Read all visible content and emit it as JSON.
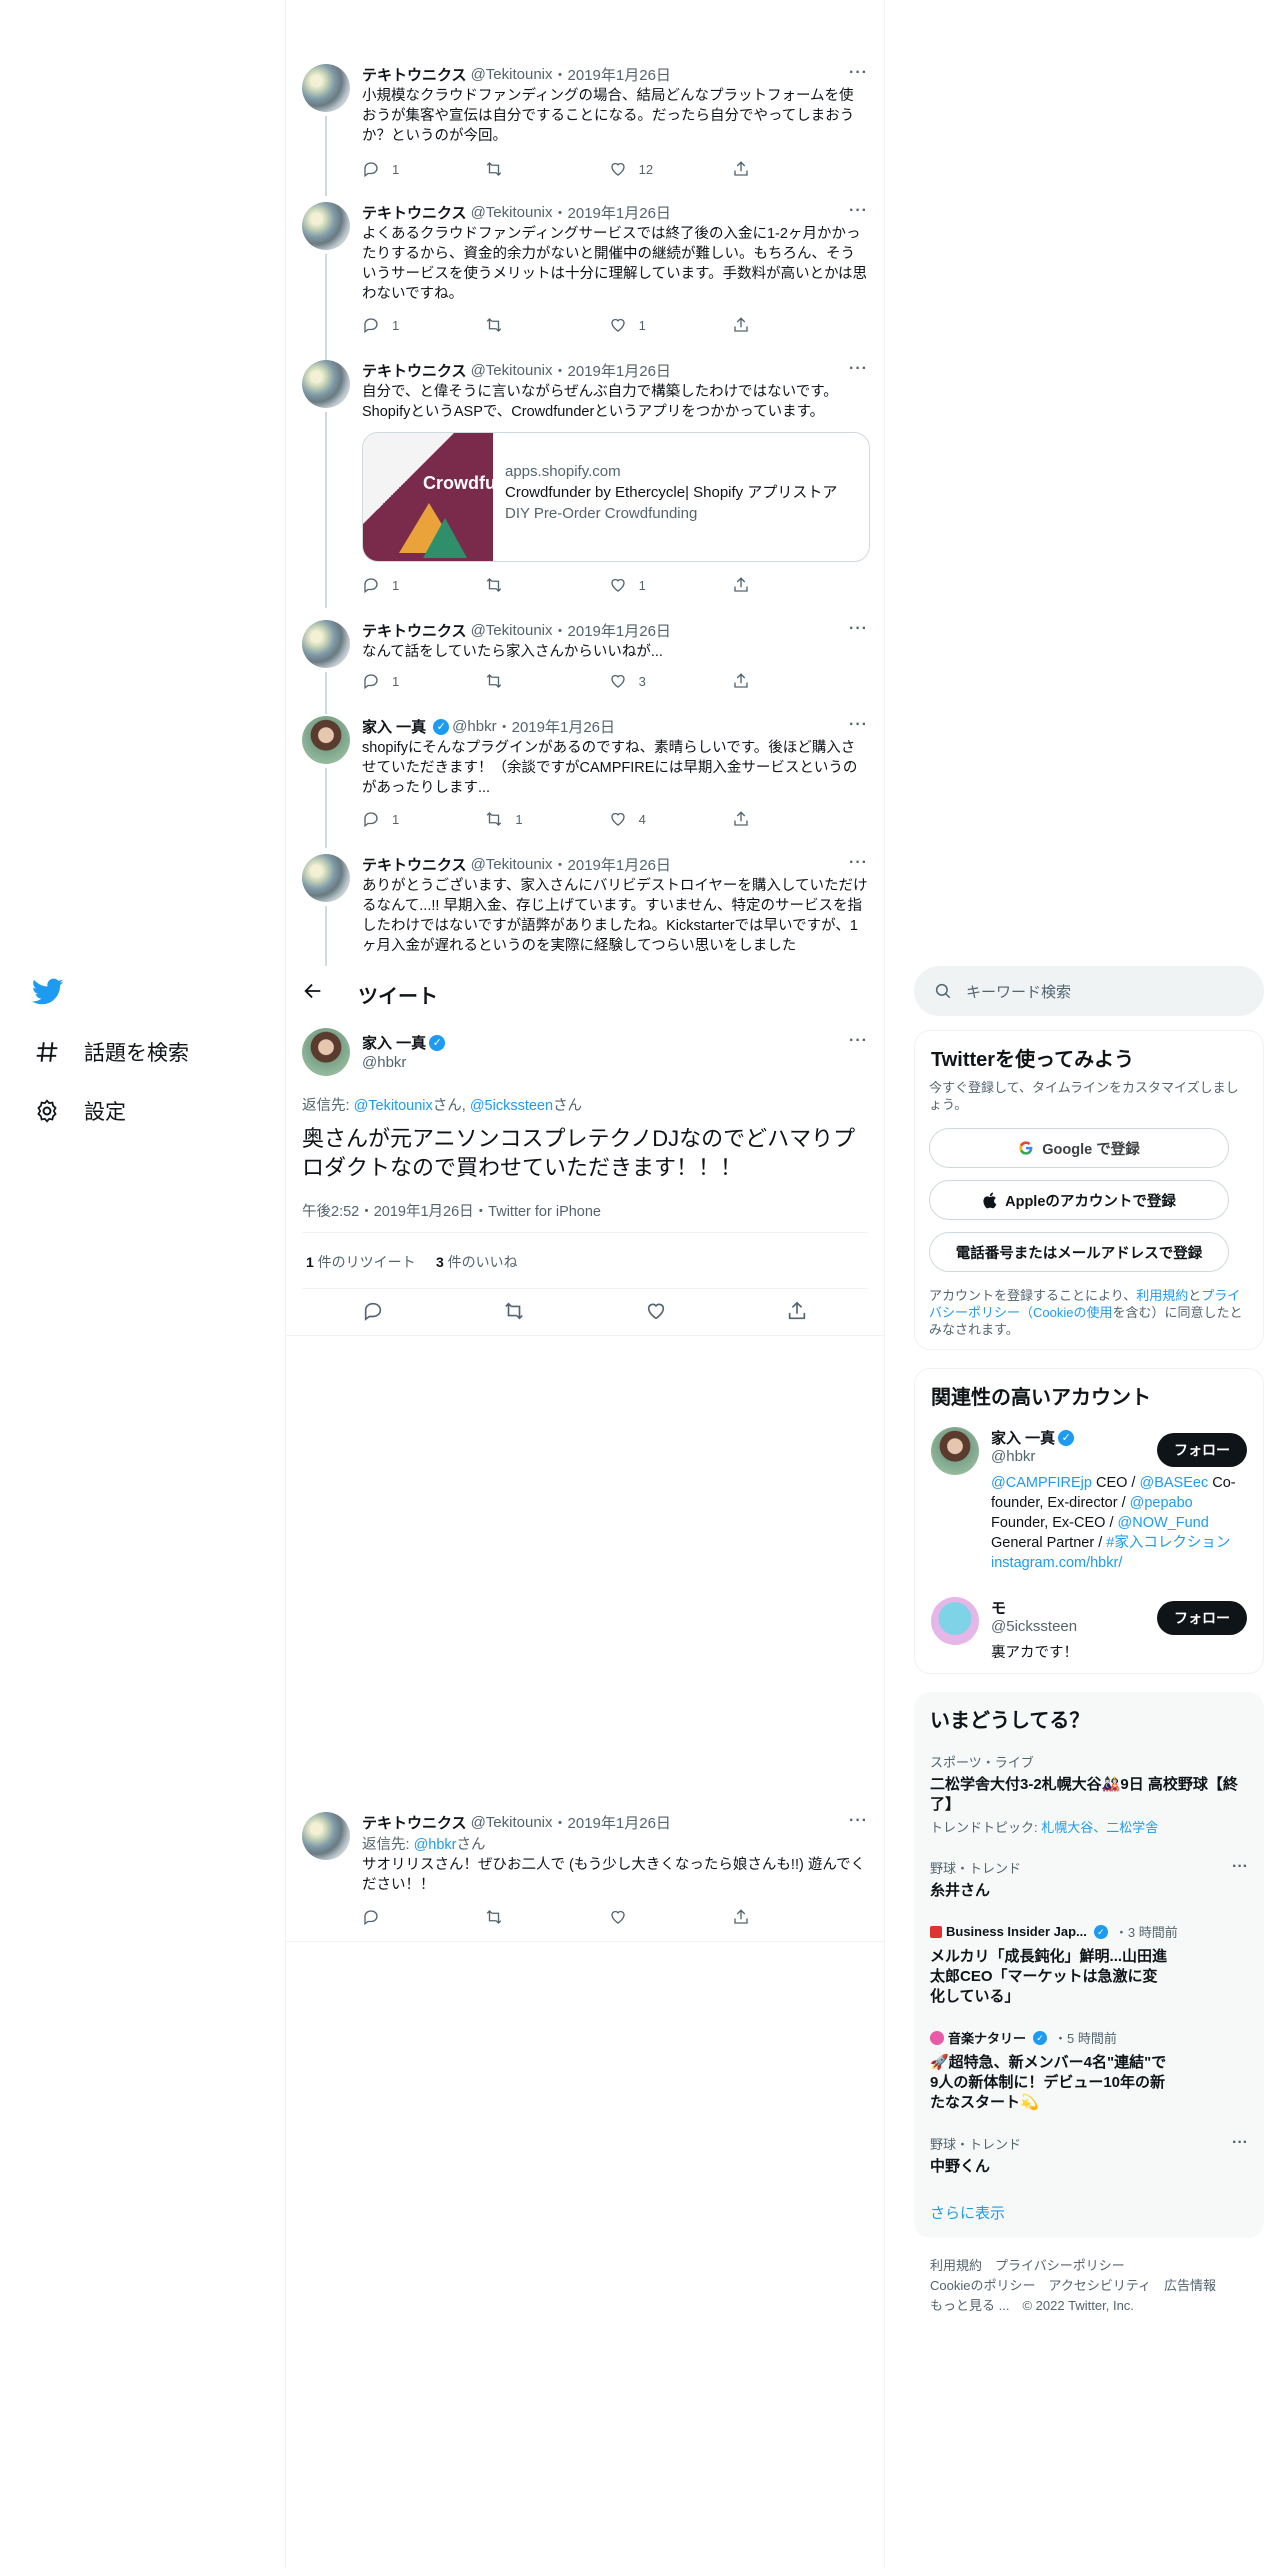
{
  "nav": {
    "explore": "話題を検索",
    "settings": "設定"
  },
  "tweets_above": [
    {
      "name": "テキトウニクス",
      "handle": "@Tekitounix",
      "date": "2019年1月26日",
      "text": "小規模なクラウドファンディングの場合、結局どんなプラットフォームを使おうが集客や宣伝は自分ですることになる。だったら自分でやってしまおうか？というのが今回。",
      "reply": "1",
      "retweet": "",
      "like": "12"
    },
    {
      "name": "テキトウニクス",
      "handle": "@Tekitounix",
      "date": "2019年1月26日",
      "text": "よくあるクラウドファンディングサービスでは終了後の入金に1-2ヶ月かかったりするから、資金的余力がないと開催中の継続が難しい。もちろん、そういうサービスを使うメリットは十分に理解しています。手数料が高いとかは思わないですね。",
      "reply": "1",
      "retweet": "",
      "like": "1"
    },
    {
      "name": "テキトウニクス",
      "handle": "@Tekitounix",
      "date": "2019年1月26日",
      "text": "自分で、と偉そうに言いながらぜんぶ自力で構築したわけではないです。ShopifyというASPで、Crowdfunderというアプリをつかかっています。",
      "card": {
        "domain": "apps.shopify.com",
        "title": "Crowdfunder by Ethercycle| Shopify アプリストア",
        "desc": "DIY Pre-Order Crowdfunding",
        "img_word": "Crowdfu"
      },
      "reply": "1",
      "retweet": "",
      "like": "1"
    },
    {
      "name": "テキトウニクス",
      "handle": "@Tekitounix",
      "date": "2019年1月26日",
      "text": "なんて話をしていたら家入さんからいいねが...",
      "reply": "1",
      "retweet": "",
      "like": "3"
    },
    {
      "name": "家入 一真",
      "handle": "@hbkr",
      "date": "2019年1月26日",
      "text": "shopifyにそんなプラグインがあるのですね、素晴らしいです。後ほど購入させていただきます！（余談ですがCAMPFIREには早期入金サービスというのがあったりします...",
      "reply": "1",
      "retweet": "1",
      "like": "4"
    },
    {
      "name": "テキトウニクス",
      "handle": "@Tekitounix",
      "date": "2019年1月26日",
      "text": "ありがとうございます、家入さんにバリビデストロイヤーを購入していただけるなんて...!! 早期入金、存じ上げています。すいません、特定のサービスを指したわけではないですが語弊がありましたね。Kickstarterでは早いですが、1ヶ月入金が遅れるというのを実際に経験してつらい思いをしました"
    }
  ],
  "header": {
    "title": "ツイート"
  },
  "focus": {
    "name": "家入 一真",
    "handle": "@hbkr",
    "reply_prefix": "返信先: ",
    "reply_to_1": "@Tekitounix",
    "reply_mid": "さん, ",
    "reply_to_2": "@5ickssteen",
    "reply_suffix": "さん",
    "text": "奥さんが元アニソンコスプレテクノDJなのでどハマりプロダクトなので買わせていただきます！！！",
    "meta": "午後2:52・2019年1月26日・Twitter for iPhone",
    "retweets_num": "1",
    "retweets_label": " 件のリツイート",
    "likes_num": "3",
    "likes_label": " 件のいいね"
  },
  "reply_tweet": {
    "name": "テキトウニクス",
    "handle": "@Tekitounix",
    "date": "2019年1月26日",
    "reply_prefix": "返信先: ",
    "reply_to": "@hbkr",
    "reply_suffix": "さん",
    "text": "サオリリスさん！ぜひお二人で (もう少し大きくなったら娘さんも!!) 遊んでください！！"
  },
  "search": {
    "placeholder": "キーワード検索"
  },
  "signup": {
    "title": "Twitterを使ってみよう",
    "subtitle": "今すぐ登録して、タイムラインをカスタマイズしましょう。",
    "google": "Google で登録",
    "apple": "Appleのアカウントで登録",
    "phone": "電話番号またはメールアドレスで登録",
    "legal_1": "アカウントを登録することにより、",
    "legal_terms": "利用規約",
    "legal_2": "と",
    "legal_privacy": "プライバシーポリシー（Cookieの使用",
    "legal_3": "を含む）に同意したとみなされます。"
  },
  "relevant": {
    "title": "関連性の高いアカウント",
    "accounts": [
      {
        "name": "家入 一真",
        "handle": "@hbkr",
        "follow": "フォロー",
        "bio_1": "@CAMPFIREjp",
        "bio_2": " CEO / ",
        "bio_3": "@BASEec",
        "bio_4": " Co-founder, Ex-director / ",
        "bio_5": "@pepabo",
        "bio_6": " Founder, Ex-CEO / ",
        "bio_7": "@NOW_Fund",
        "bio_8": " General Partner / ",
        "bio_9": "#家入コレクション",
        "bio_10": " instagram.com/hbkr/"
      },
      {
        "name": "モ",
        "handle": "@5ickssteen",
        "follow": "フォロー",
        "bio": "裏アカです！"
      }
    ]
  },
  "trends": {
    "title": "いまどうしてる？",
    "items": [
      {
        "meta": "スポーツ・ライブ",
        "title": "二松学舎大付3-2札幌大谷🎎9日 高校野球【終了】",
        "sub_label": "トレンドトピック: ",
        "sub": "札幌大谷、二松学舎"
      },
      {
        "meta": "野球・トレンド",
        "title": "糸井さん"
      },
      {
        "source": "Business Insider Jap...",
        "time": "・3 時間前",
        "title": "メルカリ「成長鈍化」鮮明...山田進太郎CEO「マーケットは急激に変化している」"
      },
      {
        "source": "音楽ナタリー",
        "time": "・5 時間前",
        "title": "🚀超特急、新メンバー4名\"連結\"で9人の新体制に！デビュー10年の新たなスタート💫"
      },
      {
        "meta": "野球・トレンド",
        "title": "中野くん"
      }
    ],
    "more": "さらに表示"
  },
  "footer": {
    "line1": "利用規約　プライバシーポリシー",
    "line2": "Cookieのポリシー　アクセシビリティ　広告情報",
    "line3": "もっと見る ...　© 2022 Twitter, Inc."
  },
  "colors": {
    "accent": "#1d9bf0",
    "text": "#0f1419",
    "muted": "#536471"
  }
}
